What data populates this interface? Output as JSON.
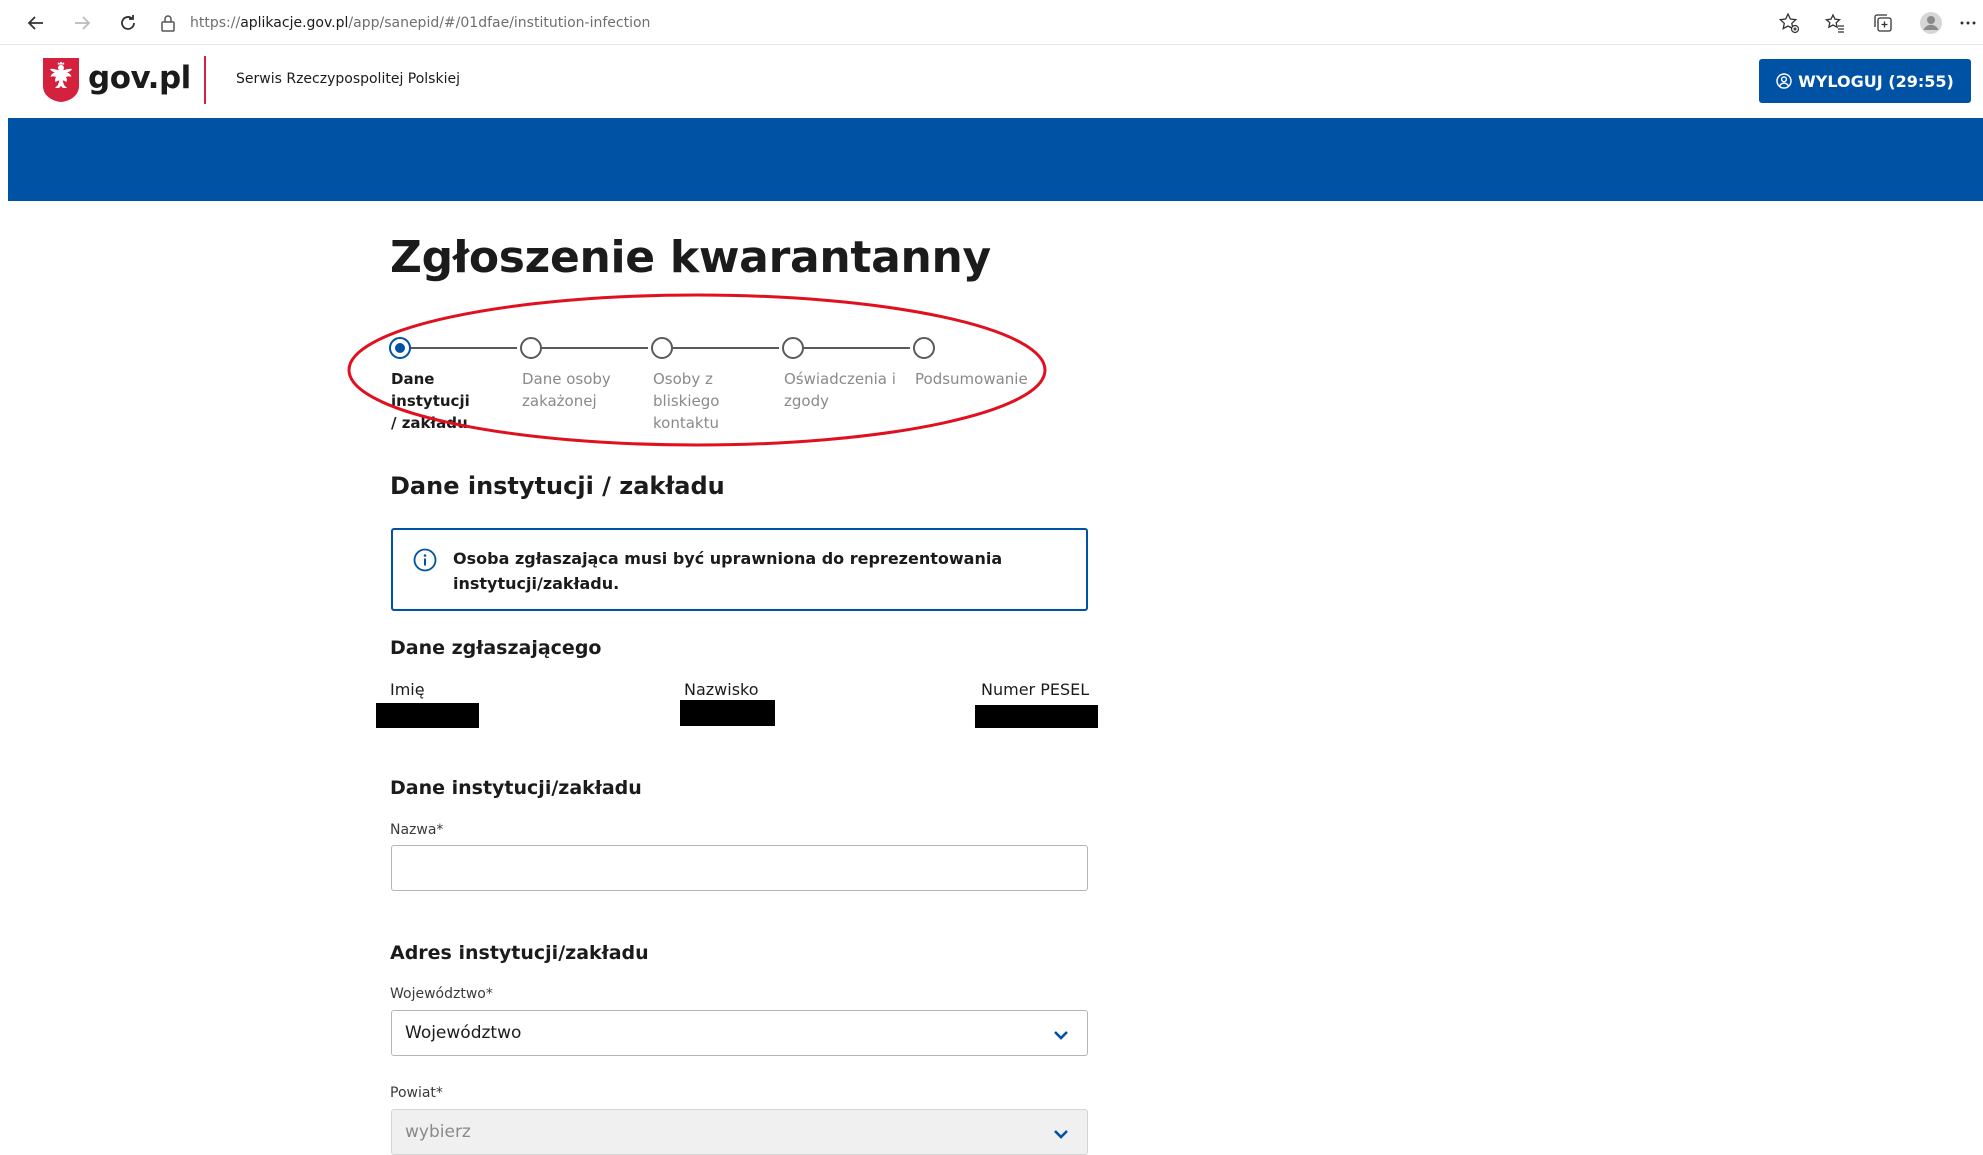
{
  "browser": {
    "url_prefix": "https://",
    "url_domain": "aplikacje.gov.pl",
    "url_path": "/app/sanepid/#/01dfae/institution-infection",
    "icons": [
      "back-arrow-icon",
      "forward-arrow-icon",
      "reload-icon",
      "lock-icon",
      "star-plus-icon",
      "favorites-icon",
      "collections-icon",
      "profile-icon",
      "more-icon"
    ]
  },
  "header": {
    "logo_text": "gov.pl",
    "service_name": "Serwis Rzeczypospolitej Polskiej",
    "logout_label": "WYLOGUJ (29:55)"
  },
  "page": {
    "title": "Zgłoszenie kwarantanny"
  },
  "stepper": {
    "steps": [
      {
        "line1": "Dane instytucji",
        "line2": "/ zakładu",
        "line3": "",
        "line4": "",
        "active": true
      },
      {
        "line1": "Dane osoby",
        "line2": "zakażonej",
        "line3": "",
        "line4": "",
        "active": false
      },
      {
        "line1": "Osoby z",
        "line2": "bliskiego",
        "line3": "kontaktu",
        "line4": "",
        "active": false
      },
      {
        "line1": "Oświadczenia i",
        "line2": "zgody",
        "line3": "",
        "line4": "",
        "active": false
      },
      {
        "line1": "Podsumowanie",
        "line2": "",
        "line3": "",
        "line4": "",
        "active": false
      }
    ],
    "highlight_color": "#e0101e"
  },
  "section": {
    "title": "Dane instytucji / zakładu",
    "info_text": "Osoba zgłaszająca musi być uprawniona do reprezentowania instytucji/zakładu."
  },
  "reporter": {
    "title": "Dane zgłaszającego",
    "first_name_label": "Imię",
    "last_name_label": "Nazwisko",
    "pesel_label": "Numer PESEL"
  },
  "institution": {
    "title": "Dane instytucji/zakładu",
    "name_label": "Nazwa*",
    "name_value": ""
  },
  "address": {
    "title": "Adres instytucji/zakładu",
    "voivodeship_label": "Województwo*",
    "voivodeship_value": "Województwo",
    "county_label": "Powiat*",
    "county_value": "wybierz"
  },
  "colors": {
    "brand_blue": "#0052a5",
    "gov_red": "#d4213d"
  }
}
